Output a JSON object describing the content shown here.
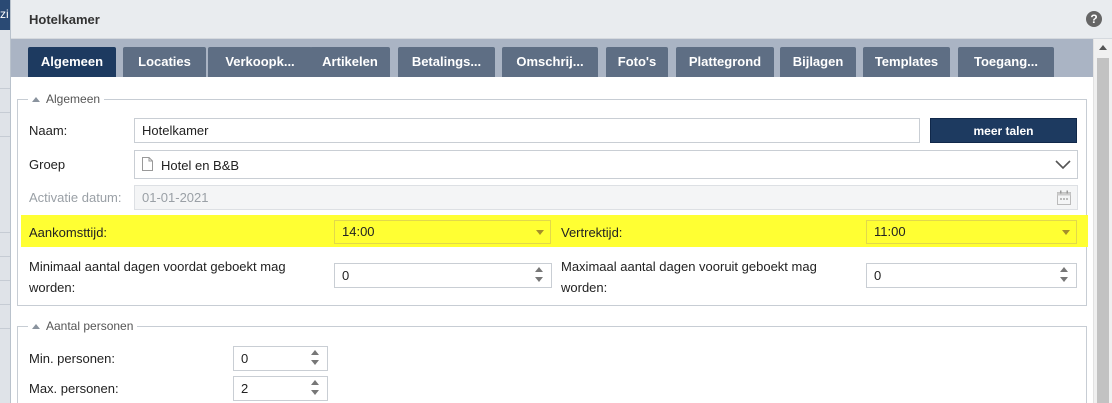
{
  "window": {
    "title": "Hotelkamer",
    "help_label": "?"
  },
  "background": {
    "fragment": "zi"
  },
  "tabs": [
    {
      "label": "Algemeen",
      "active": true
    },
    {
      "label": "Locaties"
    },
    {
      "label": "Verkoopk..."
    },
    {
      "label": "Artikelen"
    },
    {
      "label": "Betalings..."
    },
    {
      "label": "Omschrij..."
    },
    {
      "label": "Foto's"
    },
    {
      "label": "Plattegrond"
    },
    {
      "label": "Bijlagen"
    },
    {
      "label": "Templates"
    },
    {
      "label": "Toegang..."
    }
  ],
  "algemeen": {
    "legend": "Algemeen",
    "naam_label": "Naam:",
    "naam_value": "Hotelkamer",
    "meer_talen_label": "meer talen",
    "groep_label": "Groep",
    "groep_value": "Hotel en B&B",
    "activatie_label": "Activatie datum:",
    "activatie_value": "01-01-2021",
    "aankomst_label": "Aankomsttijd:",
    "aankomst_value": "14:00",
    "vertrek_label": "Vertrektijd:",
    "vertrek_value": "11:00",
    "min_dagen_label": "Minimaal aantal dagen voordat geboekt mag worden:",
    "min_dagen_value": "0",
    "max_dagen_label": "Maximaal aantal dagen vooruit geboekt mag worden:",
    "max_dagen_value": "0"
  },
  "personen": {
    "legend": "Aantal personen",
    "min_label": "Min. personen:",
    "min_value": "0",
    "max_label": "Max. personen:",
    "max_value": "2"
  },
  "colors": {
    "primary": "#1d3a60",
    "tab": "#5e6e84",
    "highlight": "#ffff33"
  }
}
